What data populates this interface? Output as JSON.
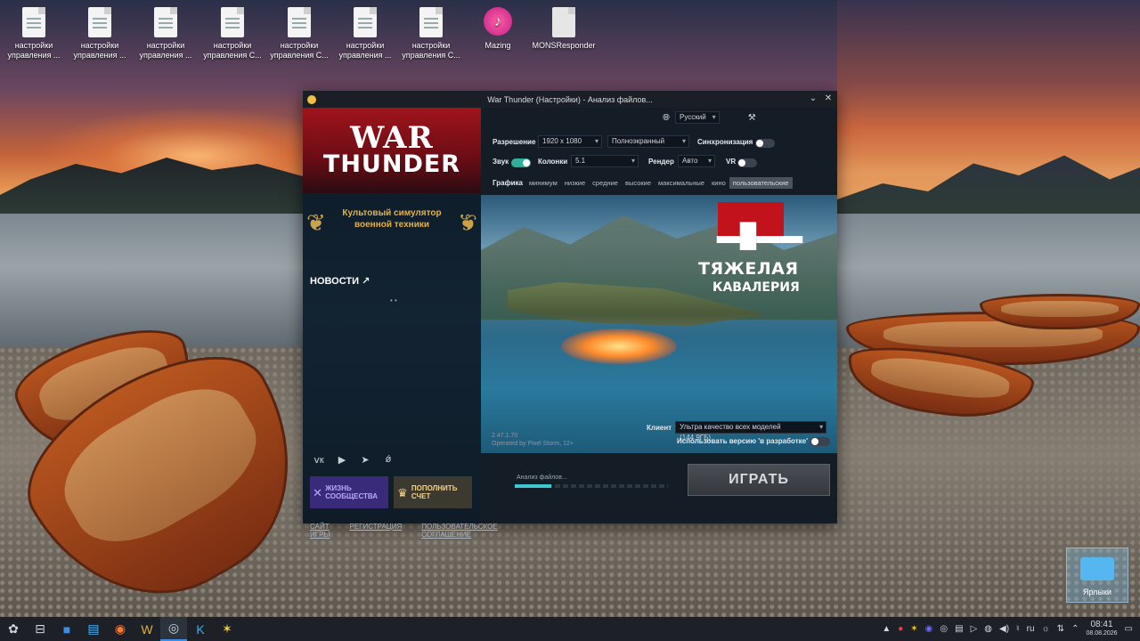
{
  "desktop": {
    "icons": [
      {
        "label": "настройки управления ...",
        "type": "file"
      },
      {
        "label": "настройки управления ...",
        "type": "file"
      },
      {
        "label": "настройки управления ...",
        "type": "file"
      },
      {
        "label": "настройки управления С...",
        "type": "file"
      },
      {
        "label": "настройки управления С...",
        "type": "file"
      },
      {
        "label": "настройки управления ...",
        "type": "file"
      },
      {
        "label": "настройки управления С...",
        "type": "file"
      },
      {
        "label": "Mazing",
        "type": "app"
      },
      {
        "label": "MONSResponder",
        "type": "file"
      }
    ],
    "folder_label": "Ярлыки"
  },
  "window": {
    "title": "War Thunder (Настройки) - Анализ файлов...",
    "controls": {
      "minimize": "⌄",
      "close": "✕"
    }
  },
  "left": {
    "logo_line1": "WAR",
    "logo_line2": "THUNDER",
    "motto": "Культовый симулятор военной техники",
    "news_label": "НОВОСТИ ↗",
    "loader": "• •",
    "social_icons": [
      "vk-icon",
      "youtube-icon",
      "telegram-icon",
      "odnoklassniki-icon"
    ],
    "social_glyphs": [
      "ⅴк",
      "▶",
      "➤",
      "ǿ"
    ],
    "promo_community": "ЖИЗНЬ СООБЩЕСТВА",
    "promo_balance": "ПОПОЛНИТЬ СЧЕТ"
  },
  "settings": {
    "language": "Русский",
    "resolution_label": "Разрешение",
    "resolution_value": "1920 x 1080",
    "mode_value": "Полноэкранный",
    "sync_label": "Синхронизация",
    "sync_on": false,
    "sound_label": "Звук",
    "sound_on": true,
    "speakers_label": "Колонки",
    "speakers_value": "5.1",
    "render_label": "Рендер",
    "render_value": "Авто",
    "vr_label": "VR",
    "vr_on": false,
    "graphics_label": "Графика",
    "presets": [
      "минимум",
      "низкие",
      "средние",
      "высокие",
      "максимальные",
      "кино",
      "пользовательские"
    ],
    "active_preset": "пользовательские"
  },
  "art": {
    "banner_line1": "ТЯЖЕЛАЯ",
    "banner_line2": "КАВАЛЕРИЯ",
    "version_line1": "2.47.1.70",
    "version_line2": "Operated by Pixel Storm, 12+"
  },
  "client": {
    "label": "Клиент",
    "value": "Ультра качество всех моделей (144.9ГБ)",
    "beta_label": "Использовать версию 'в разработке'",
    "beta_on": false
  },
  "progress": {
    "label": "Анализ файлов...",
    "fraction": 0.24
  },
  "play_label": "ИГРАТЬ",
  "footer": [
    "САЙТ ИГРЫ",
    "РЕГИСТРАЦИЯ",
    "ПОЛЬЗОВАТЕЛЬСКОЕ СОГЛАШЕНИЕ"
  ],
  "taskbar": {
    "items": [
      "start-menu-icon",
      "task-view-icon",
      "app-icon",
      "file-manager-icon",
      "firefox-icon",
      "warthunder-launcher-icon",
      "obs-icon",
      "kde-connect-icon",
      "spark-app-icon"
    ],
    "glyphs": [
      "✿",
      "⊟",
      "■",
      "▤",
      "◉",
      "W",
      "◎",
      "K",
      "✶"
    ],
    "keyboard_layout": "ru",
    "time": "08:41",
    "date": "08.08.2026"
  }
}
